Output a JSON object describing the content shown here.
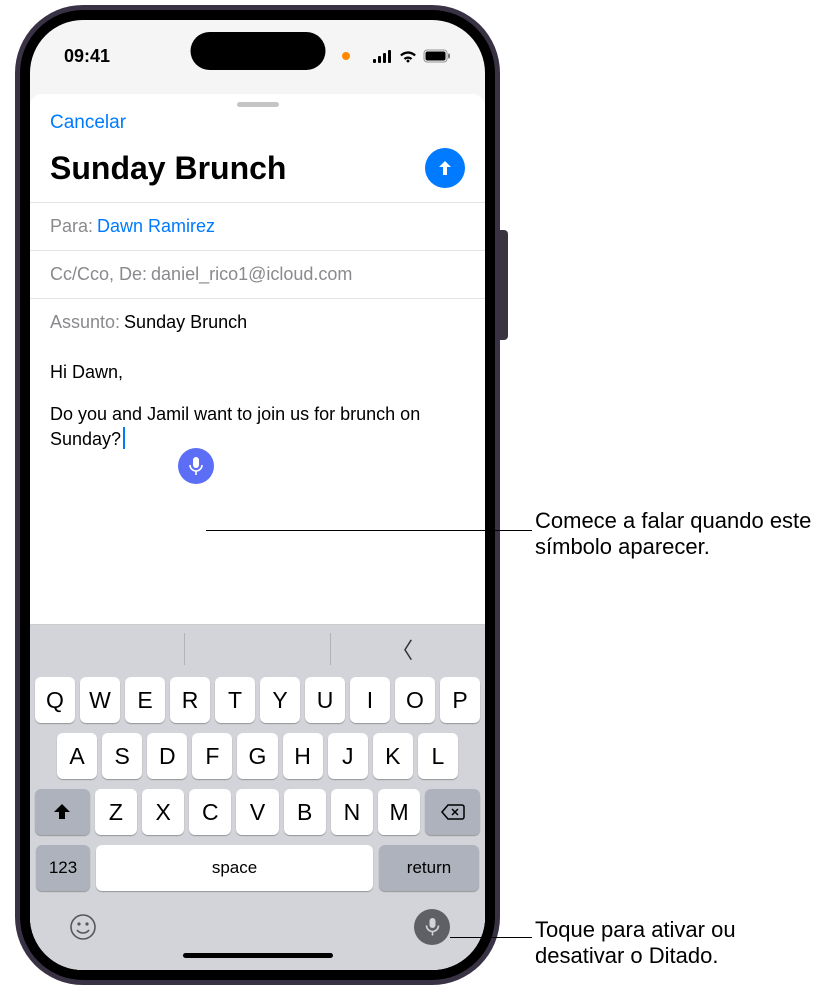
{
  "status": {
    "time": "09:41"
  },
  "sheet": {
    "cancel": "Cancelar",
    "title": "Sunday Brunch"
  },
  "fields": {
    "to_label": "Para:",
    "to_value": "Dawn Ramirez",
    "cc_label": "Cc/Cco, De:",
    "cc_value": "daniel_rico1@icloud.com",
    "subject_label": "Assunto:",
    "subject_value": "Sunday Brunch"
  },
  "body": {
    "line1": "Hi Dawn,",
    "line2": "Do you and Jamil want to join us for brunch on Sunday?"
  },
  "keyboard": {
    "row1": [
      "Q",
      "W",
      "E",
      "R",
      "T",
      "Y",
      "U",
      "I",
      "O",
      "P"
    ],
    "row2": [
      "A",
      "S",
      "D",
      "F",
      "G",
      "H",
      "J",
      "K",
      "L"
    ],
    "row3": [
      "Z",
      "X",
      "C",
      "V",
      "B",
      "N",
      "M"
    ],
    "numbers": "123",
    "space": "space",
    "return": "return"
  },
  "callouts": {
    "c1": "Comece a falar quando este símbolo aparecer.",
    "c2": "Toque para ativar ou desativar o Ditado."
  }
}
